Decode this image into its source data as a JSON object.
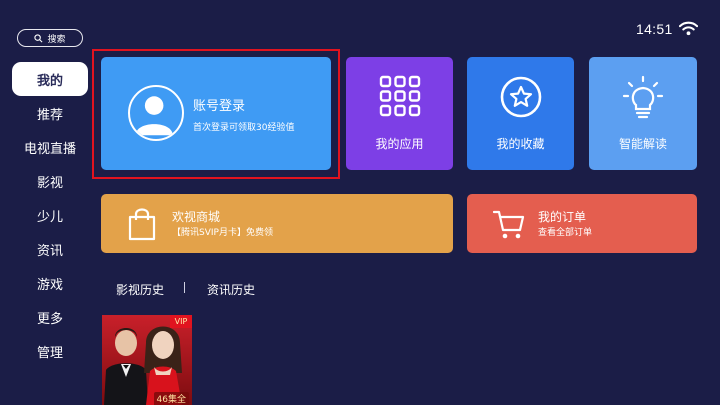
{
  "search": {
    "label": "搜索",
    "icon": "search-icon"
  },
  "status": {
    "time": "14:51",
    "wifi_icon": "wifi-icon"
  },
  "nav": {
    "items": [
      {
        "label": "我的",
        "active": true
      },
      {
        "label": "推荐"
      },
      {
        "label": "电视直播"
      },
      {
        "label": "影视"
      },
      {
        "label": "少儿"
      },
      {
        "label": "资讯"
      },
      {
        "label": "游戏"
      },
      {
        "label": "更多"
      },
      {
        "label": "管理"
      }
    ]
  },
  "cards": {
    "login": {
      "title": "账号登录",
      "subtitle": "首次登录可领取30经验值",
      "color": "#3f9bf4",
      "icon": "avatar-icon"
    },
    "apps": {
      "label": "我的应用",
      "color": "#7d3fe6",
      "icon": "apps-grid-icon"
    },
    "favorites": {
      "label": "我的收藏",
      "color": "#2f79ea",
      "icon": "star-icon"
    },
    "smart": {
      "label": "智能解读",
      "color": "#5c9ff1",
      "icon": "lightbulb-icon"
    },
    "shop": {
      "title": "欢视商城",
      "subtitle": "【腾讯SVIP月卡】免费领",
      "color": "#e3a24a",
      "icon": "shopping-bag-icon"
    },
    "orders": {
      "title": "我的订单",
      "subtitle": "查看全部订单",
      "color": "#e45e4f",
      "icon": "cart-icon"
    }
  },
  "history": {
    "tabs": [
      {
        "label": "影视历史"
      },
      {
        "label": "资讯历史"
      }
    ],
    "items": [
      {
        "badge": "VIP",
        "episodes": "46集全"
      }
    ]
  },
  "colors": {
    "background": "#1b1d47",
    "focus_outline": "#e1131f"
  }
}
